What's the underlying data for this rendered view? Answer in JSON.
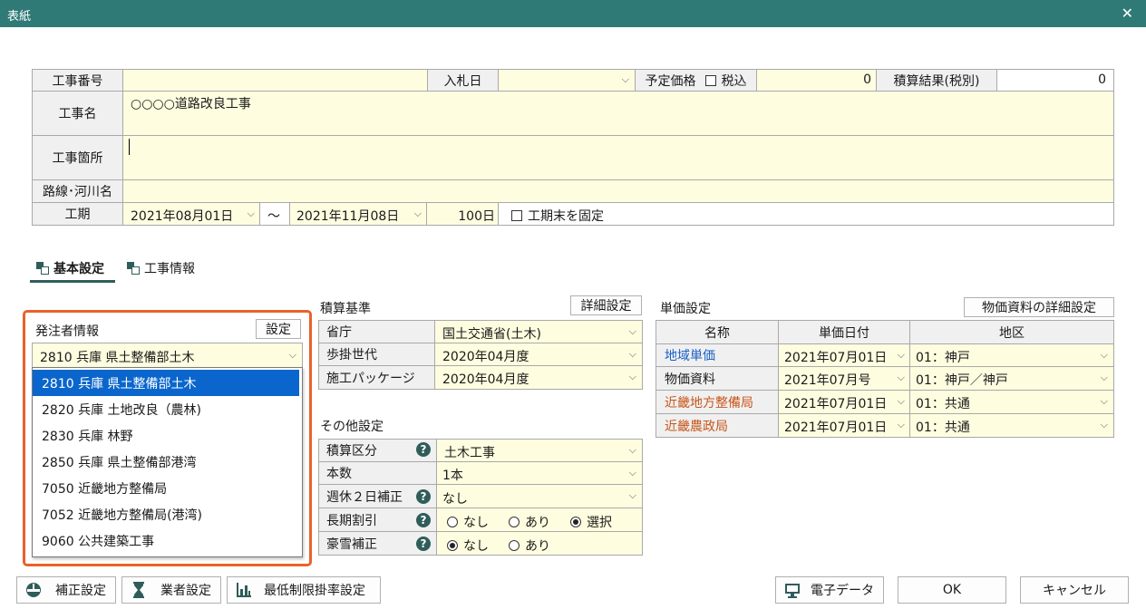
{
  "window": {
    "title": "表紙"
  },
  "project": {
    "number_label": "工事番号",
    "bid_date_label": "入札日",
    "planned_price_label": "予定価格",
    "tax_label": "税込",
    "planned_price_value": "0",
    "estimate_result_label": "積算結果(税別)",
    "estimate_result_value": "0",
    "name_label": "工事名",
    "name_value": "○○○○道路改良工事",
    "location_label": "工事箇所",
    "route_label": "路線･河川名",
    "period_label": "工期",
    "start_date": "2021年08月01日",
    "tilde": "～",
    "end_date": "2021年11月08日",
    "days": "100日",
    "fix_end_label": "工期末を固定"
  },
  "tabs": [
    {
      "label": "基本設定",
      "active": true
    },
    {
      "label": "工事情報",
      "active": false
    }
  ],
  "orderer": {
    "title": "発注者情報",
    "settings_button": "設定",
    "selected": "2810 兵庫 県土整備部土木",
    "options": [
      "2810 兵庫 県土整備部土木",
      "2820 兵庫 土地改良（農林)",
      "2830 兵庫 林野",
      "2850 兵庫 県土整備部港湾",
      "7050 近畿地方整備局",
      "7052 近畿地方整備局(港湾)",
      "9060 公共建築工事"
    ]
  },
  "estimate_basis": {
    "title": "積算基準",
    "detail_button": "詳細設定",
    "rows": [
      {
        "label": "省庁",
        "value": "国土交通省(土木)"
      },
      {
        "label": "歩掛世代",
        "value": "2020年04月度"
      },
      {
        "label": "施工パッケージ",
        "value": "2020年04月度"
      }
    ]
  },
  "other_settings": {
    "title": "その他設定",
    "category_label": "積算区分",
    "category_value": "土木工事",
    "count_label": "本数",
    "count_value": "1本",
    "weekly_label": "週休２日補正",
    "weekly_value": "なし",
    "long_term_label": "長期割引",
    "long_term_options": [
      "なし",
      "あり",
      "選択"
    ],
    "long_term_selected": 2,
    "snow_label": "豪雪補正",
    "snow_options": [
      "なし",
      "あり"
    ],
    "snow_selected": 0
  },
  "unit_price": {
    "title": "単価設定",
    "detail_button": "物価資料の詳細設定",
    "headers": [
      "名称",
      "単価日付",
      "地区"
    ],
    "rows": [
      {
        "name": "地域単価",
        "date": "2021年07月01日",
        "area": "01：神戸",
        "color": "#1a5fc8"
      },
      {
        "name": "物価資料",
        "date": "2021年07月号",
        "area": "01：神戸／神戸",
        "color": "#1a1a1a"
      },
      {
        "name": "近畿地方整備局",
        "date": "2021年07月01日",
        "area": "01：共通",
        "color": "#c8561a"
      },
      {
        "name": "近畿農政局",
        "date": "2021年07月01日",
        "area": "01：共通",
        "color": "#c8561a"
      }
    ]
  },
  "footer": {
    "correction": "補正設定",
    "contractor": "業者設定",
    "min_rate": "最低制限掛率設定",
    "electronic": "電子データ",
    "ok": "OK",
    "cancel": "キャンセル"
  },
  "colors": {
    "titlebar": "#2f7a76",
    "highlight_border": "#e8622c",
    "selection": "#0a66cc",
    "input_bg": "#fffde0"
  }
}
